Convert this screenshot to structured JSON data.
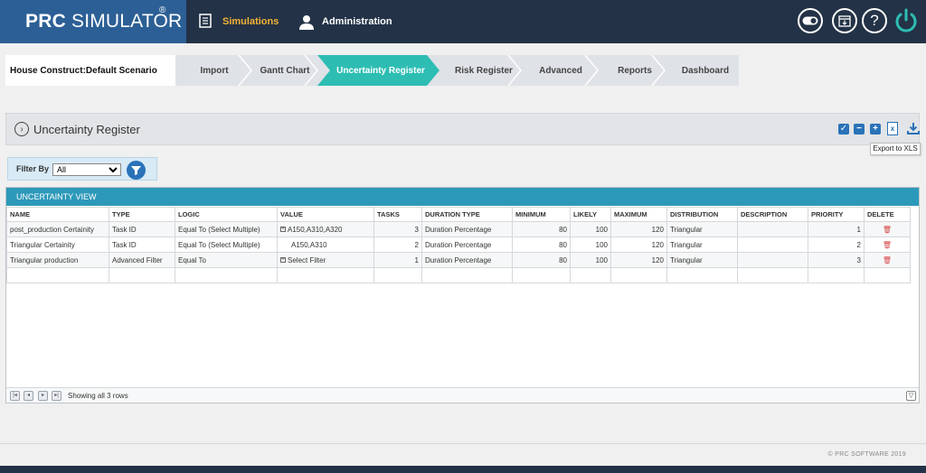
{
  "app": {
    "brand_prefix": "PRC",
    "brand_suffix": "SIMULATOR",
    "brand_mark": "®",
    "nav": {
      "simulations": "Simulations",
      "administration": "Administration"
    },
    "icons": [
      "toggle-icon",
      "calendar-download-icon",
      "help-icon",
      "power-icon"
    ]
  },
  "project": {
    "name": "House Construct",
    "separator": ":",
    "scenario": "Default Scenario"
  },
  "steps": [
    {
      "label": "Import",
      "active": false
    },
    {
      "label": "Gantt Chart",
      "active": false
    },
    {
      "label": "Uncertainty Register",
      "active": true
    },
    {
      "label": "Risk Register",
      "active": false
    },
    {
      "label": "Advanced",
      "active": false
    },
    {
      "label": "Reports",
      "active": false
    },
    {
      "label": "Dashboard",
      "active": false
    }
  ],
  "section": {
    "title": "Uncertainty Register",
    "tooltip": "Export to XLS"
  },
  "filter": {
    "label": "Filter By",
    "selected": "All"
  },
  "grid": {
    "caption": "UNCERTAINTY VIEW",
    "columns": [
      "NAME",
      "TYPE",
      "LOGIC",
      "VALUE",
      "TASKS",
      "DURATION TYPE",
      "MINIMUM",
      "LIKELY",
      "MAXIMUM",
      "DISTRIBUTION",
      "DESCRIPTION",
      "PRIORITY",
      "DELETE"
    ],
    "rows": [
      {
        "name": "post_production Certainity",
        "type": "Task ID",
        "logic": "Equal To (Select Multiple)",
        "value": "A150,A310,A320",
        "value_expand": true,
        "tasks": "3",
        "duration_type": "Duration Percentage",
        "minimum": "80",
        "likely": "100",
        "maximum": "120",
        "distribution": "Triangular",
        "description": "",
        "priority": "1"
      },
      {
        "name": "Triangular Certainity",
        "type": "Task ID",
        "logic": "Equal To (Select Multiple)",
        "value": "A150,A310",
        "value_expand": false,
        "tasks": "2",
        "duration_type": "Duration Percentage",
        "minimum": "80",
        "likely": "100",
        "maximum": "120",
        "distribution": "Triangular",
        "description": "",
        "priority": "2"
      },
      {
        "name": "Triangular production",
        "type": "Advanced Filter",
        "logic": "Equal To",
        "value": "Select Filter",
        "value_expand": true,
        "tasks": "1",
        "duration_type": "Duration Percentage",
        "minimum": "80",
        "likely": "100",
        "maximum": "120",
        "distribution": "Triangular",
        "description": "",
        "priority": "3"
      }
    ],
    "status": "Showing all 3 rows"
  },
  "footer": {
    "copyright": "© PRC SOFTWARE 2019"
  },
  "colors": {
    "topbar": "#233246",
    "brand": "#2c5f95",
    "active_step": "#2dbdb3",
    "grid_caption": "#2d99ba",
    "nav_active": "#f5b335"
  }
}
